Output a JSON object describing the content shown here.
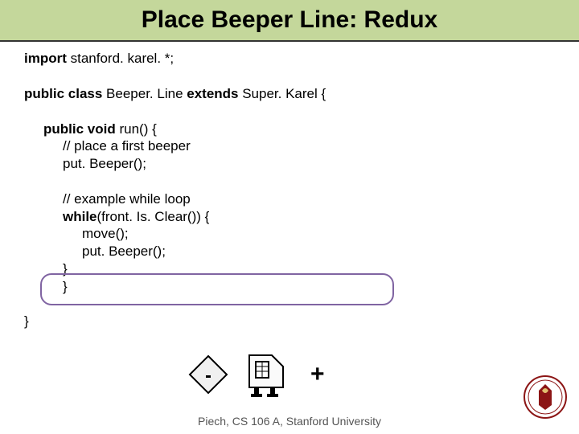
{
  "title": "Place Beeper Line: Redux",
  "code": {
    "import_kw": "import",
    "import_rest": " stanford. karel. *;",
    "class_kw1": "public class",
    "class_mid": " Beeper. Line ",
    "class_kw2": "extends",
    "class_rest": " Super. Karel {",
    "run_kw": "public void",
    "run_rest": " run() {",
    "comment1": "// place a first beeper",
    "put1": "put. Beeper();",
    "comment2": "// example while loop",
    "while_kw": "while",
    "while_rest": "(front. Is. Clear()) {",
    "move": "move();",
    "put2": "put. Beeper();",
    "close1": "}",
    "close2": "}",
    "close3": "}"
  },
  "plus": "+",
  "footer": "Piech, CS 106 A, Stanford University"
}
